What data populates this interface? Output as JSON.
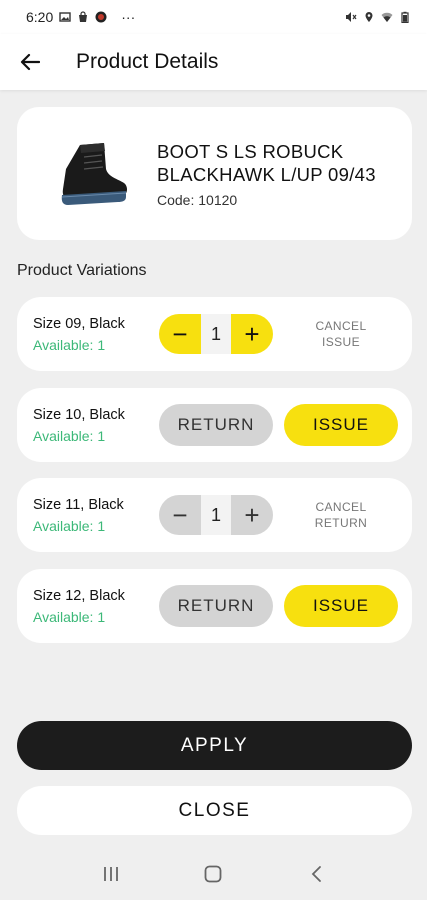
{
  "status_bar": {
    "time": "6:20",
    "icons_left": [
      "image-icon",
      "bag-icon",
      "notification-app-icon",
      "more-dots-icon"
    ],
    "icons_right": [
      "mute-icon",
      "location-icon",
      "wifi-icon",
      "battery-icon"
    ],
    "dots": "···"
  },
  "app_bar": {
    "title": "Product Details",
    "back_icon": "arrow-left-icon"
  },
  "product": {
    "name": "BOOT S LS ROBUCK BLACKHAWK L/UP 09/43",
    "code": "Code: 10120",
    "image": "boot-image"
  },
  "variations_title": "Product Variations",
  "variations": [
    {
      "size": "Size 09, Black",
      "available": "Available: 1",
      "quantity": "1",
      "minus": "−",
      "plus": "+",
      "action": "CANCEL ISSUE"
    },
    {
      "size": "Size 10, Black",
      "available": "Available: 1",
      "return_label": "RETURN",
      "issue_label": "ISSUE"
    },
    {
      "size": "Size 11, Black",
      "available": "Available: 1",
      "quantity": "1",
      "minus": "−",
      "plus": "+",
      "action": "CANCEL RETURN"
    },
    {
      "size": "Size 12, Black",
      "available": "Available: 1",
      "return_label": "RETURN",
      "issue_label": "ISSUE"
    }
  ],
  "footer": {
    "apply_label": "APPLY",
    "close_label": "CLOSE"
  },
  "colors": {
    "accent_yellow": "#f7e00f",
    "available_green": "#3cb878",
    "apply_dark": "#1c1c1c",
    "background": "#efefef"
  },
  "nav_bar": {
    "icons": [
      "recent-apps-icon",
      "home-icon",
      "back-nav-icon"
    ]
  }
}
